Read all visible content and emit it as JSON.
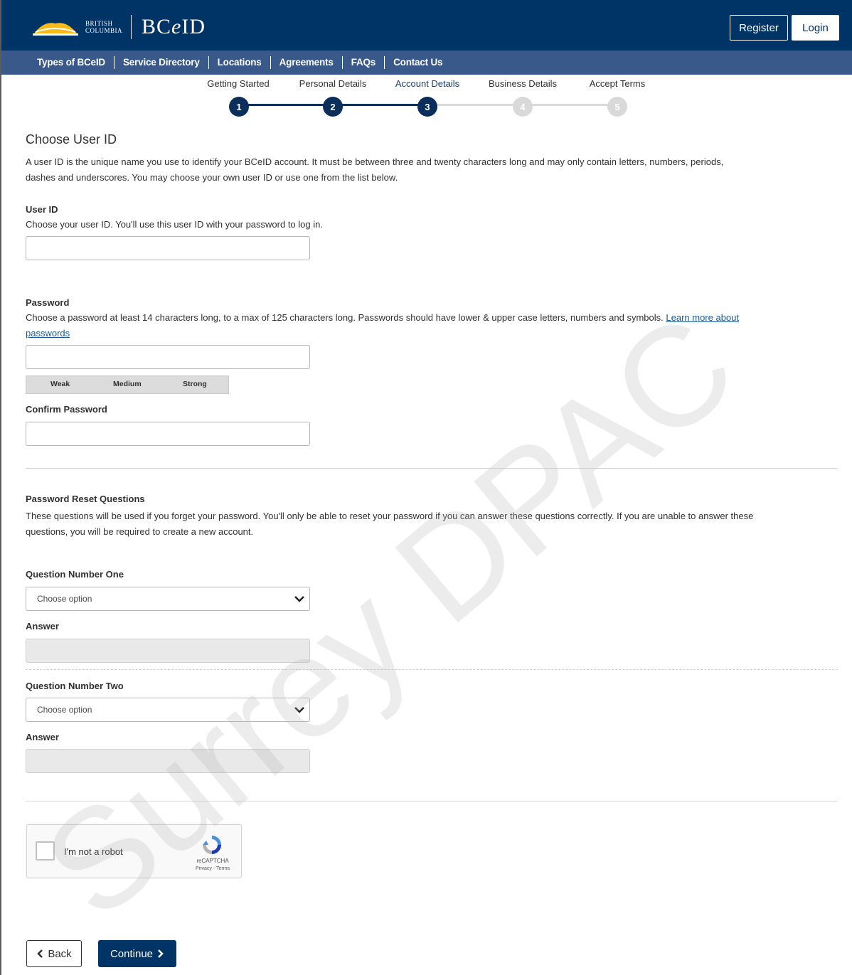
{
  "header": {
    "logo_text_line1": "BRITISH",
    "logo_text_line2": "COLUMBIA",
    "brand_prefix": "BC",
    "brand_italic": "e",
    "brand_suffix": "ID",
    "register_label": "Register",
    "login_label": "Login"
  },
  "nav": {
    "items": [
      "Types of BCeID",
      "Service Directory",
      "Locations",
      "Agreements",
      "FAQs",
      "Contact Us"
    ]
  },
  "stepper": {
    "steps": [
      {
        "label": "Getting Started",
        "number": "1"
      },
      {
        "label": "Personal Details",
        "number": "2"
      },
      {
        "label": "Account Details",
        "number": "3"
      },
      {
        "label": "Business Details",
        "number": "4"
      },
      {
        "label": "Accept Terms",
        "number": "5"
      }
    ],
    "active_color": "#0b2e5a",
    "inactive_color": "#d9d9d9"
  },
  "section_user_id": {
    "heading": "Choose User ID",
    "description_line1": "A user ID is the unique name you use to identify your BCeID account. It must be between three and twenty characters long and may only contain letters, numbers, periods,",
    "description_line2": "dashes and underscores. You may choose your own user ID or use one from the list below.",
    "user_id_label": "User ID",
    "user_id_help": "Choose your user ID. You'll use this user ID with your password to log in.",
    "user_id_value": ""
  },
  "section_password": {
    "label": "Password",
    "help_line1": "Choose a password at least 14 characters long, to a max of 125 characters long. Passwords should have lower & upper case letters, numbers and symbols.",
    "help_link_part1": "Learn more about",
    "help_link_part2": "passwords",
    "strength_weak": "Weak",
    "strength_medium": "Medium",
    "strength_strong": "Strong",
    "confirm_label": "Confirm Password"
  },
  "section_reset": {
    "heading": "Password Reset Questions",
    "description_line1": "These questions will be used if you forget your password. You'll only be able to reset your password if you can answer these questions correctly. If you are unable to answer these",
    "description_line2": "questions, you will be required to create a new account.",
    "q1_label": "Question Number One",
    "q1_placeholder": "Choose option",
    "answer1_label": "Answer",
    "q2_label": "Question Number Two",
    "q2_placeholder": "Choose option",
    "answer2_label": "Answer"
  },
  "captcha": {
    "label": "I'm not a robot",
    "brand": "reCAPTCHA",
    "terms": "Privacy - Terms"
  },
  "actions": {
    "back_label": "Back",
    "continue_label": "Continue"
  },
  "watermark": "Surrey DPAC",
  "colors": {
    "header_bg": "#003366",
    "nav_bg": "#38598a",
    "accent_gold": "#fcba19",
    "primary_button": "#003366",
    "link": "#1a5a96"
  }
}
